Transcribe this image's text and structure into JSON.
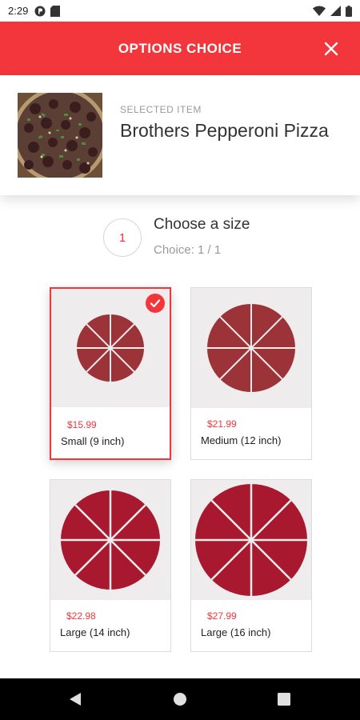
{
  "status_bar": {
    "time": "2:29"
  },
  "header": {
    "title": "OPTIONS CHOICE"
  },
  "selected_item": {
    "label": "SELECTED ITEM",
    "name": "Brothers Pepperoni Pizza"
  },
  "step": {
    "number": "1",
    "title": "Choose a size",
    "subtitle": "Choice: 1 / 1"
  },
  "options": [
    {
      "price": "$15.99",
      "label": "Small (9 inch)",
      "selected": true
    },
    {
      "price": "$21.99",
      "label": "Medium (12 inch)",
      "selected": false
    },
    {
      "price": "$22.98",
      "label": "Large (14 inch)",
      "selected": false
    },
    {
      "price": "$27.99",
      "label": "Large (16 inch)",
      "selected": false
    }
  ],
  "colors": {
    "accent": "#f2363b",
    "pizza_small": "#9c3338",
    "pizza_large": "#a8182f"
  }
}
